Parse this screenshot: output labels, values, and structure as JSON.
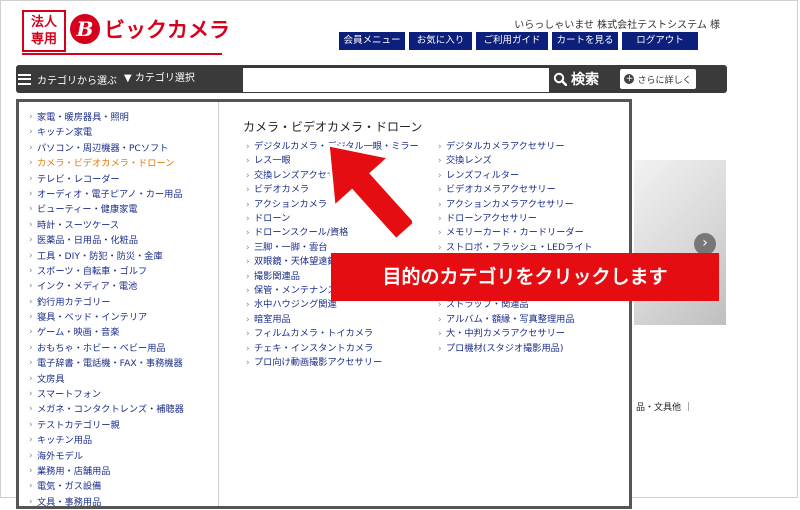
{
  "header": {
    "logo_line1": "法人",
    "logo_line2": "専用",
    "logo_mark": "B",
    "logo_text": "ビックカメラ",
    "welcome": "いらっしゃいませ 株式会社テストシステム 様",
    "nav": [
      "会員メニュー",
      "お気に入り",
      "ご利用ガイド",
      "カートを見る",
      "ログアウト"
    ]
  },
  "search": {
    "menu_label": "カテゴリから選ぶ",
    "category_select": "▼ カテゴリ選択",
    "input_value": "",
    "button_label": "検索",
    "detail_label": "さらに詳しく"
  },
  "left_categories": [
    "家電・暖房器具・照明",
    "キッチン家電",
    "パソコン・周辺機器・PCソフト",
    "カメラ・ビデオカメラ・ドローン",
    "テレビ・レコーダー",
    "オーディオ・電子ピアノ・カー用品",
    "ビューティー・健康家電",
    "時計・スーツケース",
    "医薬品・日用品・化粧品",
    "工具・DIY・防犯・防災・金庫",
    "スポーツ・自転車・ゴルフ",
    "インク・メディア・電池",
    "釣行用カテゴリー",
    "寝具・ベッド・インテリア",
    "ゲーム・映画・音楽",
    "おもちゃ・ホビー・ベビー用品",
    "電子辞書・電話機・FAX・事務機器",
    "文房具",
    "スマートフォン",
    "メガネ・コンタクトレンズ・補聴器",
    "テストカテゴリー親",
    "キッチン用品",
    "海外モデル",
    "業務用・店舗用品",
    "電気・ガス設備",
    "文具・事務用品"
  ],
  "active_category": "カメラ・ビデオカメラ・ドローン",
  "right_panel": {
    "title": "カメラ・ビデオカメラ・ドローン",
    "col1": [
      "デジタルカメラ・デジタル一眼・ミラー",
      "レス一眼",
      "交換レンズアクセサリー",
      "ビデオカメラ",
      "アクションカメラ",
      "ドローン",
      "ドローンスクール/資格",
      "三脚・一脚・雲台",
      "双眼鏡・天体望遠鏡",
      "撮影関連品",
      "保管・メンテナンス",
      "水中ハウジング関連",
      "暗室用品",
      "フィルムカメラ・トイカメラ",
      "チェキ・インスタントカメラ",
      "プロ向け動画撮影アクセサリー"
    ],
    "col2": [
      "デジタルカメラアクセサリー",
      "交換レンズ",
      "レンズフィルター",
      "ビデオカメラアクセサリー",
      "アクションカメラアクセサリー",
      "ドローンアクセサリー",
      "メモリーカード・カードリーダー",
      "ストロボ・フラッシュ・LEDライト",
      "",
      "",
      "",
      "ストラップ・関連品",
      "アルバム・額縁・写真整理用品",
      "大・中判カメラアクセサリー",
      "プロ機材(スタジオ撮影用品)"
    ]
  },
  "background_text": "品・文具他 ｜",
  "callout_text": "目的のカテゴリをクリックします",
  "colors": {
    "brand_red": "#d6001c",
    "nav_blue": "#0c1f7a",
    "callout_red": "#e60d12",
    "link_blue": "#1a2d8a",
    "active_orange": "#e07a00"
  }
}
